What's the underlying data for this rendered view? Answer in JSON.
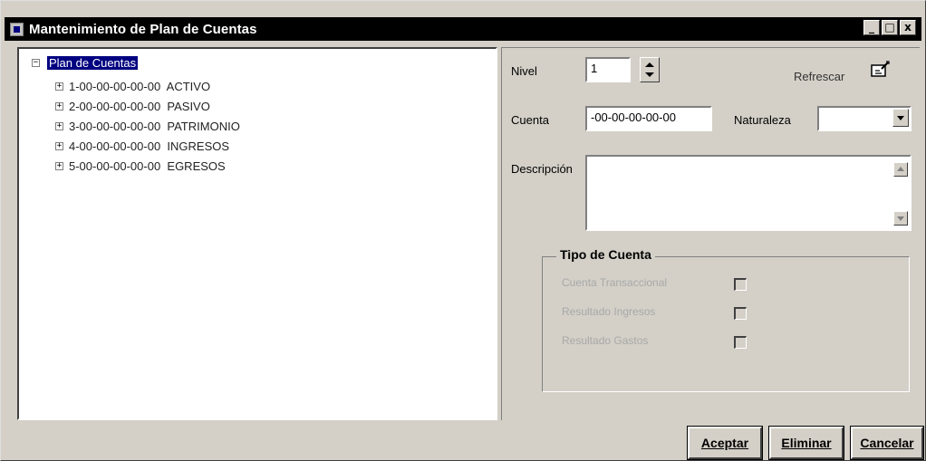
{
  "window": {
    "title": "Mantenimiento de Plan de Cuentas",
    "controls": {
      "minimize": "_",
      "maximize": "□",
      "close": "x"
    }
  },
  "tree": {
    "root_label": "Plan de Cuentas",
    "root_expander": "−",
    "items": [
      {
        "expander": "+",
        "label": "1-00-00-00-00-00  ACTIVO"
      },
      {
        "expander": "+",
        "label": "2-00-00-00-00-00  PASIVO"
      },
      {
        "expander": "+",
        "label": "3-00-00-00-00-00  PATRIMONIO"
      },
      {
        "expander": "+",
        "label": "4-00-00-00-00-00  INGRESOS"
      },
      {
        "expander": "+",
        "label": "5-00-00-00-00-00  EGRESOS"
      }
    ]
  },
  "form": {
    "nivel_label": "Nivel",
    "nivel_value": "1",
    "refrescar_label": "Refrescar",
    "cuenta_label": "Cuenta",
    "cuenta_value": "-00-00-00-00-00",
    "naturaleza_label": "Naturaleza",
    "naturaleza_value": "",
    "descripcion_label": "Descripción",
    "descripcion_value": ""
  },
  "tipo_cuenta": {
    "title": "Tipo de Cuenta",
    "options": [
      {
        "label": "Cuenta Transaccional",
        "checked": false
      },
      {
        "label": "Resultado Ingresos",
        "checked": false
      },
      {
        "label": "Resultado Gastos",
        "checked": false
      }
    ]
  },
  "buttons": {
    "aceptar": "Aceptar",
    "eliminar": "Eliminar",
    "cancelar": "Cancelar"
  },
  "icons": {
    "app": "app-icon",
    "refresh": "refresh-icon"
  }
}
